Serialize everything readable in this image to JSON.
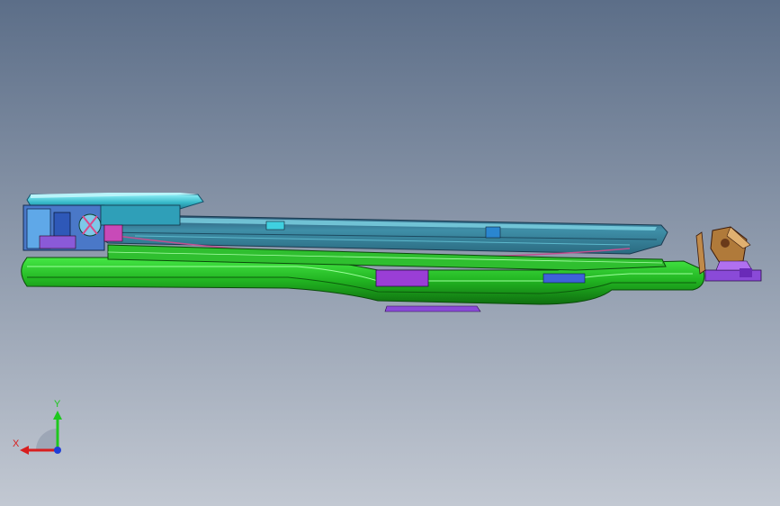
{
  "viewport": {
    "background_top": "#5c6e88",
    "background_bottom": "#c2c8d2",
    "model_name": "",
    "parts": [
      {
        "name": "seat-cushion-frame",
        "color": "#3ec8d8"
      },
      {
        "name": "seat-pan-top",
        "color": "#2f9aa8"
      },
      {
        "name": "seat-rail-bottom",
        "color": "#2ec82e"
      },
      {
        "name": "side-rail-tube",
        "color": "#35d635"
      },
      {
        "name": "recliner-mechanism",
        "color": "#3e62d8"
      },
      {
        "name": "purple-bracket",
        "color": "#9a3ed6"
      },
      {
        "name": "front-mount-bracket",
        "color": "#b07a3a"
      },
      {
        "name": "front-mount-plate",
        "color": "#8a4ad8"
      }
    ]
  },
  "triad": {
    "x_label": "X",
    "y_label": "Y",
    "x_color": "#d81e1e",
    "y_color": "#1ec81e",
    "z_color": "#1e3ed8"
  }
}
